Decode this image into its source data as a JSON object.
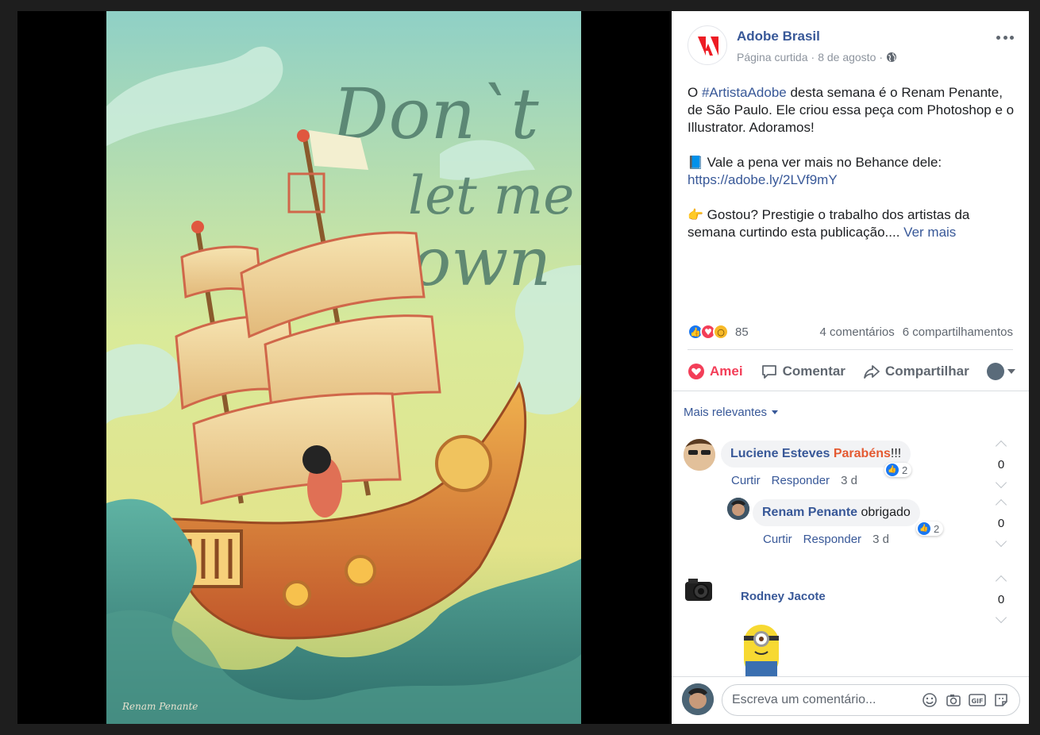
{
  "post": {
    "page_name": "Adobe Brasil",
    "meta_status": "Página curtida",
    "meta_date": "8 de agosto",
    "text_part1_pre": "O ",
    "hashtag": "#ArtistaAdobe",
    "text_part1_post": " desta semana é o Renam Penante, de São Paulo. Ele criou essa peça com Photoshop e o Illustrator. Adoramos!",
    "book_emoji": "📘",
    "text_part2": " Vale a pena ver mais no Behance dele:",
    "link": "https://adobe.ly/2LVf9mY",
    "hand_emoji": "👉",
    "text_part3": " Gostou? Prestigie o trabalho dos artistas da semana curtindo esta publicação....",
    "see_more": "Ver mais"
  },
  "artwork": {
    "line1": "Don`t",
    "line2": "let me",
    "line3": "down",
    "signature": "Renam Penante"
  },
  "reactions": {
    "count": "85",
    "comments": "4 comentários",
    "shares": "6 compartilhamentos"
  },
  "actions": {
    "love": "Amei",
    "comment": "Comentar",
    "share": "Compartilhar"
  },
  "comments_section": {
    "relevance": "Mais relevantes",
    "items": [
      {
        "author": "Luciene Esteves",
        "tag": "Parabéns",
        "text": "!!!",
        "like": "Curtir",
        "reply": "Responder",
        "time": "3 d",
        "likes": "2",
        "votes": "0"
      },
      {
        "author": "Renam Penante",
        "text": "obrigado",
        "like": "Curtir",
        "reply": "Responder",
        "time": "3 d",
        "likes": "2",
        "votes": "0"
      },
      {
        "author": "Rodney Jacote",
        "votes": "0"
      }
    ]
  },
  "compose": {
    "placeholder": "Escreva um comentário..."
  },
  "colors": {
    "fb_link": "#385898",
    "love": "#f33e58",
    "like": "#1877f2"
  }
}
